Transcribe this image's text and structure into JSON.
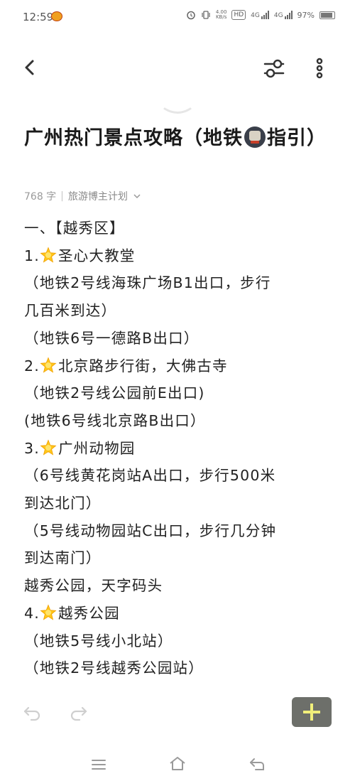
{
  "status_bar": {
    "time": "12:59",
    "speed_value": "4.00",
    "speed_unit": "KB/s",
    "hd_label": "HD",
    "network1": "4G",
    "network2": "4G",
    "battery": "97%"
  },
  "app_bar": {
    "icons": [
      "back-arrow-icon",
      "tune-sliders-icon",
      "more-vertical-icon"
    ]
  },
  "note": {
    "title_before_icon": "广州热门景点攻略（地铁",
    "title_after_icon": "指引）",
    "char_count": "768 字",
    "category": "旅游博主计划",
    "lines": [
      {
        "text": "一、【越秀区】",
        "star": false
      },
      {
        "text": "1.",
        "star": true,
        "after": "圣心大教堂"
      },
      {
        "text": "（地铁2号线海珠广场B1出口，步行",
        "star": false
      },
      {
        "text": "几百米到达）",
        "star": false
      },
      {
        "text": "（地铁6号一德路B出口）",
        "star": false
      },
      {
        "text": "2.",
        "star": true,
        "after": "北京路步行街，大佛古寺"
      },
      {
        "text": "（地铁2号线公园前E出口)",
        "star": false
      },
      {
        "text": "(地铁6号线北京路B出口）",
        "star": false
      },
      {
        "text": "3.",
        "star": true,
        "after": "广州动物园"
      },
      {
        "text": "（6号线黄花岗站A出口，步行500米",
        "star": false
      },
      {
        "text": "到达北门）",
        "star": false
      },
      {
        "text": "（5号线动物园站C出口，步行几分钟",
        "star": false
      },
      {
        "text": "到达南门）",
        "star": false
      },
      {
        "text": "越秀公园，天字码头",
        "star": false
      },
      {
        "text": "4.",
        "star": true,
        "after": "越秀公园"
      },
      {
        "text": "（地铁5号线小北站）",
        "star": false
      },
      {
        "text": "（地铁2号线越秀公园站）",
        "star": false
      }
    ]
  },
  "toolbar": {
    "icons": [
      "undo-icon",
      "redo-icon",
      "add-icon"
    ],
    "add_color": "#f1ef7a"
  },
  "nav_bar": {
    "icons": [
      "menu-icon",
      "home-icon",
      "back-icon"
    ]
  },
  "colors": {
    "text": "#222222",
    "muted": "#9a9a9a",
    "add_button_bg": "#6d6f6a"
  }
}
